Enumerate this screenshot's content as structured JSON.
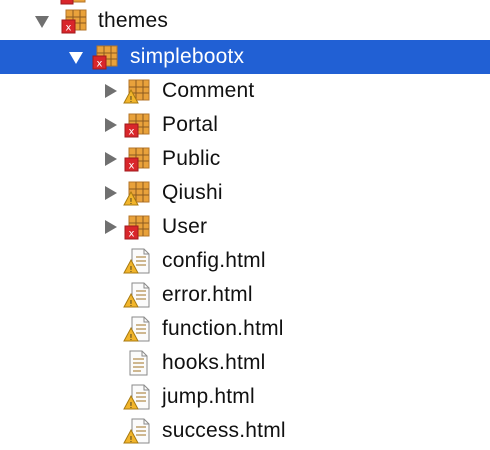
{
  "tree": {
    "items": [
      {
        "label": "themes",
        "depth": 0,
        "type": "folder",
        "expanded": true,
        "selected": false
      },
      {
        "label": "simplebootx",
        "depth": 1,
        "type": "folder",
        "expanded": true,
        "selected": true
      },
      {
        "label": "Comment",
        "depth": 2,
        "type": "folder",
        "expanded": false,
        "selected": false,
        "error": false
      },
      {
        "label": "Portal",
        "depth": 2,
        "type": "folder",
        "expanded": false,
        "selected": false,
        "error": true
      },
      {
        "label": "Public",
        "depth": 2,
        "type": "folder",
        "expanded": false,
        "selected": false,
        "error": true
      },
      {
        "label": "Qiushi",
        "depth": 2,
        "type": "folder",
        "expanded": false,
        "selected": false,
        "error": false
      },
      {
        "label": "User",
        "depth": 2,
        "type": "folder",
        "expanded": false,
        "selected": false,
        "error": true
      },
      {
        "label": "config.html",
        "depth": 2,
        "type": "file",
        "warning": true
      },
      {
        "label": "error.html",
        "depth": 2,
        "type": "file",
        "warning": true
      },
      {
        "label": "function.html",
        "depth": 2,
        "type": "file",
        "warning": true
      },
      {
        "label": "hooks.html",
        "depth": 2,
        "type": "file",
        "warning": false
      },
      {
        "label": "jump.html",
        "depth": 2,
        "type": "file",
        "warning": true
      },
      {
        "label": "success.html",
        "depth": 2,
        "type": "file",
        "warning": true
      }
    ]
  },
  "colors": {
    "selection": "#2160d4",
    "folder": "#e9a23b",
    "error": "#d9262b",
    "warning": "#f2b52b"
  }
}
